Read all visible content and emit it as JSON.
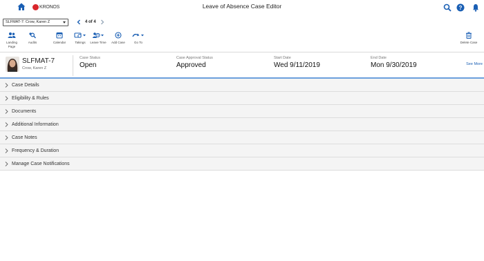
{
  "topbar": {
    "logo_text": "KRONOS",
    "title": "Leave of Absence Case Editor",
    "icons": [
      "home-icon",
      "search-icon",
      "help-icon",
      "bell-icon"
    ]
  },
  "selector": {
    "case_value": "SLFMAT-7: Crow, Karen Z",
    "pager": "4 of 4"
  },
  "toolbar": {
    "landing_page": "Landing Page",
    "audits": "Audits",
    "calendar": "Calendar",
    "takings": "Takings",
    "leave_time": "Leave Time",
    "add_case": "Add Case",
    "go_to": "Go To",
    "delete_case": "Delete Case"
  },
  "case": {
    "id": "SLFMAT-7",
    "owner": "Crow, Karen Z",
    "status_label": "Case Status",
    "status_value": "Open",
    "approval_label": "Case Approval Status",
    "approval_value": "Approved",
    "start_label": "Start Date",
    "start_value": "Wed 9/11/2019",
    "end_label": "End Date",
    "end_value": "Mon 9/30/2019",
    "see_more": "See More"
  },
  "sections": [
    "Case Details",
    "Eligibility & Rules",
    "Documents",
    "Additional Information",
    "Case Notes",
    "Frequency & Duration",
    "Manage Case Notifications"
  ],
  "colors": {
    "accent": "#1a5fb4",
    "highlight": "#6b9fdc",
    "brand_red": "#d9262c"
  }
}
